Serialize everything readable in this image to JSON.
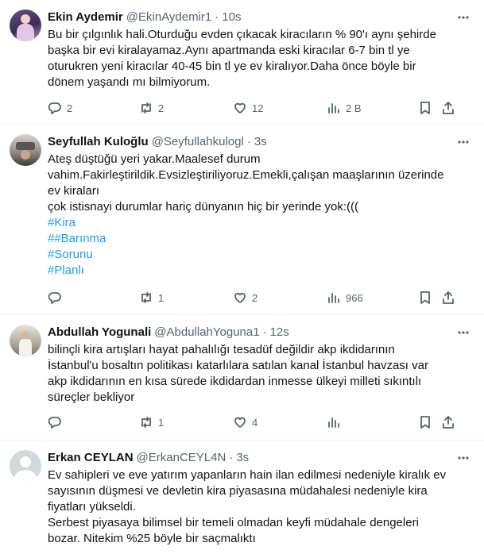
{
  "tweets": [
    {
      "name": "Ekin Aydemir",
      "handle": "@EkinAydemir1",
      "time": "10s",
      "text": "Bu bir çılgınlık hali.Oturduğu evden çıkacak kiracıların % 90'ı aynı şehirde\nbaşka bir evi kiralayamaz.Aynı apartmanda eski kiracılar 6-7 bin tl ye\noturukren yeni kiracılar 40-45 bin tl ye ev kiralıyor.Daha önce böyle bir\ndönem yaşandı mı bilmiyorum.",
      "replies": "2",
      "retweets": "2",
      "likes": "12",
      "views": "2 B",
      "more_icon": "more-dots-icon"
    },
    {
      "name": "Seyfullah Kuloğlu",
      "handle": "@Seyfullahkulogl",
      "time": "3s",
      "text": "Ateş düştüğü yeri yakar.Maalesef durum\nvahim.Fakirleştirildik.Evsizleştiriliyoruz.Emekli,çalışan maaşlarının üzerinde\nev kiraları\nçok istisnayi durumlar hariç dünyanın hiç bir yerinde yok:(((",
      "tags": [
        "#Kira",
        "##Barınma",
        "#Sorunu",
        "#Planlı"
      ],
      "replies": "",
      "retweets": "1",
      "likes": "2",
      "views": "966"
    },
    {
      "name": "Abdullah Yogunali",
      "handle": "@AbdullahYoguna1",
      "time": "12s",
      "text": "bilinçli kira artışları hayat pahalılığı tesadüf değildir akp ikdidarının\nİstanbul'u bosaltın politikası katarlılara satılan kanal İstanbul havzası var\nakp ikdidarının en kısa sürede ikdidardan inmesse ülkeyi milleti sıkıntılı\nsüreçler bekliyor",
      "replies": "",
      "retweets": "1",
      "likes": "4",
      "views": ""
    },
    {
      "name": "Erkan CEYLAN",
      "handle": "@ErkanCEYL4N",
      "time": "3s",
      "text": "Ev sahipleri ve eve yatırım yapanların hain ilan edilmesi nedeniyle kiralık ev\nsayısının düşmesi ve devletin kira piyasasına müdahalesi nedeniyle kira\nfiyatları yükseldi.\nSerbest piyasaya bilimsel bir temeli olmadan keyfi müdahale dengeleri\nbozar. Nitekim %25 böyle bir saçmalıktı"
    }
  ],
  "separator": "·"
}
